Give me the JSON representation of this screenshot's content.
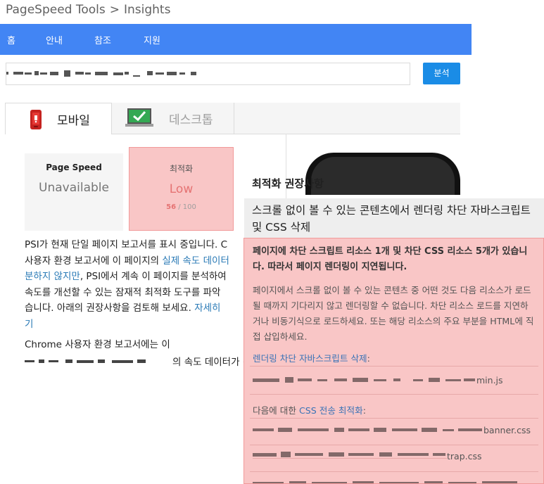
{
  "breadcrumb": {
    "root": "PageSpeed Tools",
    "separator": ">",
    "current": "Insights"
  },
  "nav": {
    "items": [
      {
        "label": "홈"
      },
      {
        "label": "안내"
      },
      {
        "label": "참조"
      },
      {
        "label": "지원"
      }
    ]
  },
  "search": {
    "analyze_label": "분석"
  },
  "tabs": {
    "mobile_label": "모바일",
    "desktop_label": "데스크톱"
  },
  "cards": {
    "page_speed": {
      "title": "Page Speed",
      "value": "Unavailable"
    },
    "optimization": {
      "title": "최적화",
      "value": "Low",
      "score": "56",
      "score_sep": " / ",
      "score_max": "100",
      "score_fraction": 0.56
    }
  },
  "main": {
    "para_a": "PSI가 현재 단일 페이지 보고서를 표시 중입니다. C",
    "para_b": "사용자 환경 보고서에 이 페이지의 ",
    "para_link1": "실제 속도 데이터",
    "para_c": "분하지 않지만",
    "para_d": ", PSI에서 계속 이 페이지를 분석하여",
    "para_e": "속도를 개선할 수 있는 잠재적 최적화 도구를 파악",
    "para_f": "습니다. 아래의 권장사항을 검토해 보세요. ",
    "para_link2": "자세히",
    "para_g": "기",
    "para2_line1": "Chrome 사용자 환경 보고서에는 이",
    "para2_line2_tail": "의 속도 데이터가 진지"
  },
  "popup": {
    "title": "최적화 권장사항",
    "heading": "스크롤 없이 볼 수 있는 콘텐츠에서 렌더링 차단 자바스크립트 및 CSS 삭제",
    "summary": "페이지에 차단 스크립트 리소스 1개 및 차단 CSS 리소스 5개가 있습니다. 따라서 페이지 렌더링이 지연됩니다.",
    "description": "페이지에서 스크롤 없이 볼 수 있는 콘텐츠 중 어떤 것도 다음 리소스가 로드될 때까지 기다리지 않고 렌더링할 수 없습니다. 차단 리소스 로드를 지연하거나 비동기식으로 로드하세요. 또는 해당 리소스의 주요 부분을 HTML에 직접 삽입하세요.",
    "js_link": "렌더링 차단 자바스크립트 삭제",
    "js_colon": ":",
    "js_file_tail": "min.js",
    "css_prefix": "다음에 대한 ",
    "css_link": "CSS 전송 최적화",
    "css_colon": ":",
    "css_file1_tail": "banner.css",
    "css_file2_tail": "trap.css"
  },
  "colors": {
    "nav_blue": "#4285f4",
    "analyze_blue": "#1a8ce6",
    "flag_red": "#f19a9a",
    "flag_fill": "#f9c6c6",
    "link": "#2a7ab6"
  },
  "icons": {
    "mobile_tab": "mobile-phone-icon",
    "desktop_tab": "desktop-monitor-icon"
  }
}
